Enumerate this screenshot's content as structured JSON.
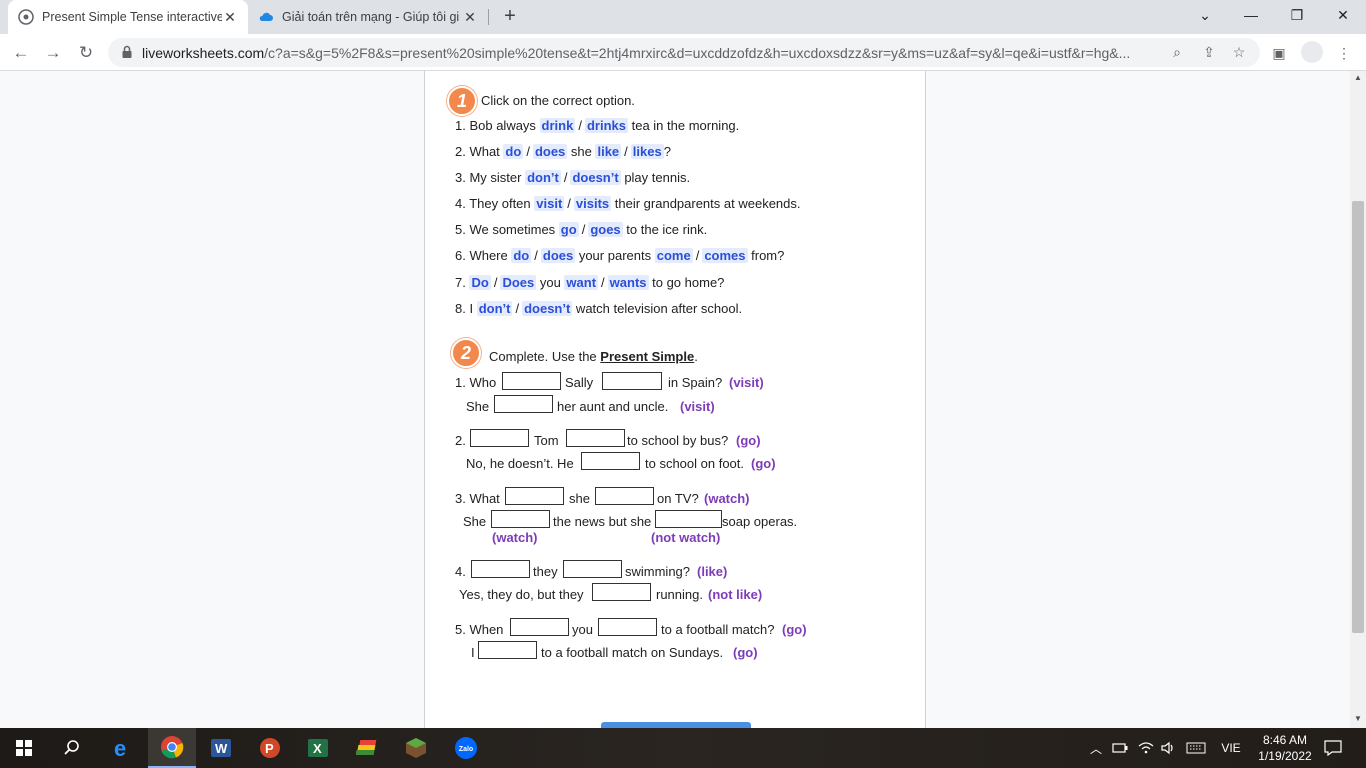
{
  "browser": {
    "tabs": [
      {
        "title": "Present Simple Tense interactive",
        "active": true
      },
      {
        "title": "Giải toán trên mạng - Giúp tôi gi",
        "active": false
      }
    ],
    "url_host": "liveworksheets.com",
    "url_rest": "/c?a=s&g=5%2F8&s=present%20simple%20tense&t=2htj4mrxirc&d=uxcddzofdz&h=uxcdoxsdzz&sr=y&ms=uz&af=sy&l=qe&i=ustf&r=hg&..."
  },
  "exercise1": {
    "number": "1",
    "instruction": "Click on the correct option.",
    "items": [
      {
        "pre": "1. Bob always ",
        "a": "drink",
        "b": "drinks",
        "mid": " tea in the morning.",
        "c": "",
        "d": "",
        "post": ""
      },
      {
        "pre": "2. What ",
        "a": "do",
        "b": "does",
        "mid": " she ",
        "c": "like",
        "d": "likes",
        "post": "?"
      },
      {
        "pre": "3. My sister ",
        "a": "don’t",
        "b": "doesn’t",
        "mid": " play tennis.",
        "c": "",
        "d": "",
        "post": ""
      },
      {
        "pre": "4. They often ",
        "a": "visit",
        "b": "visits",
        "mid": " their grandparents at weekends.",
        "c": "",
        "d": "",
        "post": ""
      },
      {
        "pre": "5. We sometimes ",
        "a": "go",
        "b": "goes",
        "mid": " to the ice rink.",
        "c": "",
        "d": "",
        "post": ""
      },
      {
        "pre": "6. Where ",
        "a": "do",
        "b": "does",
        "mid": " your parents ",
        "c": "come",
        "d": "comes",
        "post": " from?"
      },
      {
        "pre": "7. ",
        "a": "Do",
        "b": "Does",
        "mid": " you ",
        "c": "want",
        "d": "wants",
        "post": " to go home?"
      },
      {
        "pre": "8. I ",
        "a": "don’t",
        "b": "doesn’t",
        "mid": " watch television after school.",
        "c": "",
        "d": "",
        "post": ""
      }
    ]
  },
  "exercise2": {
    "number": "2",
    "instruction_pre": "Complete. Use the ",
    "instruction_bold": "Present Simple",
    "instruction_post": ".",
    "q1": {
      "a": "1. Who",
      "b": "Sally",
      "c": "in Spain?",
      "hint": "(visit)",
      "r_a": "She",
      "r_b": "her aunt and uncle.",
      "r_hint": "(visit)"
    },
    "q2": {
      "a": "2.",
      "b": "Tom",
      "c": "to school by bus?",
      "hint": "(go)",
      "r_a": "No, he doesn’t. He",
      "r_b": "to school on foot.",
      "r_hint": "(go)"
    },
    "q3": {
      "a": "3. What",
      "b": "she",
      "c": "on TV?",
      "hint": "(watch)",
      "r_a": "She",
      "r_b": "the news but she",
      "r_c": "soap operas.",
      "r_hint1": "(watch)",
      "r_hint2": "(not watch)"
    },
    "q4": {
      "a": "4.",
      "b": "they",
      "c": "swimming?",
      "hint": "(like)",
      "r_a": "Yes, they do, but they",
      "r_b": "running.",
      "r_hint": "(not like)"
    },
    "q5": {
      "a": "5. When",
      "b": "you",
      "c": "to a football match?",
      "hint": "(go)",
      "r_a": "I",
      "r_b": "to a football match on Sundays.",
      "r_hint": "(go)"
    }
  },
  "taskbar": {
    "zalo_label": "Zalo",
    "lang": "VIE",
    "time": "8:46 AM",
    "date": "1/19/2022"
  },
  "colors": {
    "choice_bg": "#e3ebfd",
    "choice_text": "#2b4fd6",
    "hint": "#7d3bb8",
    "badge": "#f2884b"
  }
}
